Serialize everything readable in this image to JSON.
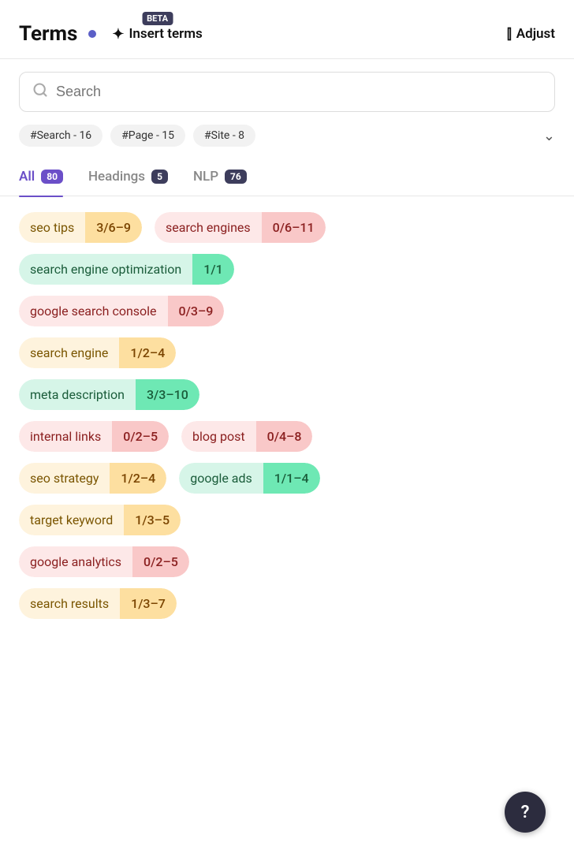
{
  "header": {
    "title": "Terms",
    "dot_color": "#5b5fc7",
    "insert_label": "Insert terms",
    "beta_label": "BETA",
    "adjust_label": "Adjust"
  },
  "search": {
    "placeholder": "Search"
  },
  "filter_chips": [
    {
      "label": "#Search - 16"
    },
    {
      "label": "#Page - 15"
    },
    {
      "label": "#Site - 8"
    }
  ],
  "tabs": [
    {
      "label": "All",
      "badge": "80",
      "active": true
    },
    {
      "label": "Headings",
      "badge": "5",
      "active": false
    },
    {
      "label": "NLP",
      "badge": "76",
      "active": false
    }
  ],
  "terms": [
    {
      "row": [
        {
          "label": "seo tips",
          "count": "3/6–9",
          "style": "yellow"
        },
        {
          "label": "search engines",
          "count": "0/6–11",
          "style": "pink"
        }
      ]
    },
    {
      "row": [
        {
          "label": "search engine optimization",
          "count": "1/1",
          "style": "green"
        }
      ]
    },
    {
      "row": [
        {
          "label": "google search console",
          "count": "0/3–9",
          "style": "pink"
        }
      ]
    },
    {
      "row": [
        {
          "label": "search engine",
          "count": "1/2–4",
          "style": "yellow"
        }
      ]
    },
    {
      "row": [
        {
          "label": "meta description",
          "count": "3/3–10",
          "style": "green"
        }
      ]
    },
    {
      "row": [
        {
          "label": "internal links",
          "count": "0/2–5",
          "style": "pink"
        },
        {
          "label": "blog post",
          "count": "0/4–8",
          "style": "pink"
        }
      ]
    },
    {
      "row": [
        {
          "label": "seo strategy",
          "count": "1/2–4",
          "style": "yellow"
        },
        {
          "label": "google ads",
          "count": "1/1–4",
          "style": "green"
        }
      ]
    },
    {
      "row": [
        {
          "label": "target keyword",
          "count": "1/3–5",
          "style": "yellow"
        }
      ]
    },
    {
      "row": [
        {
          "label": "google analytics",
          "count": "0/2–5",
          "style": "pink"
        }
      ]
    },
    {
      "row": [
        {
          "label": "search results",
          "count": "1/3–7",
          "style": "yellow"
        }
      ]
    }
  ],
  "help_button": {
    "label": "?"
  }
}
